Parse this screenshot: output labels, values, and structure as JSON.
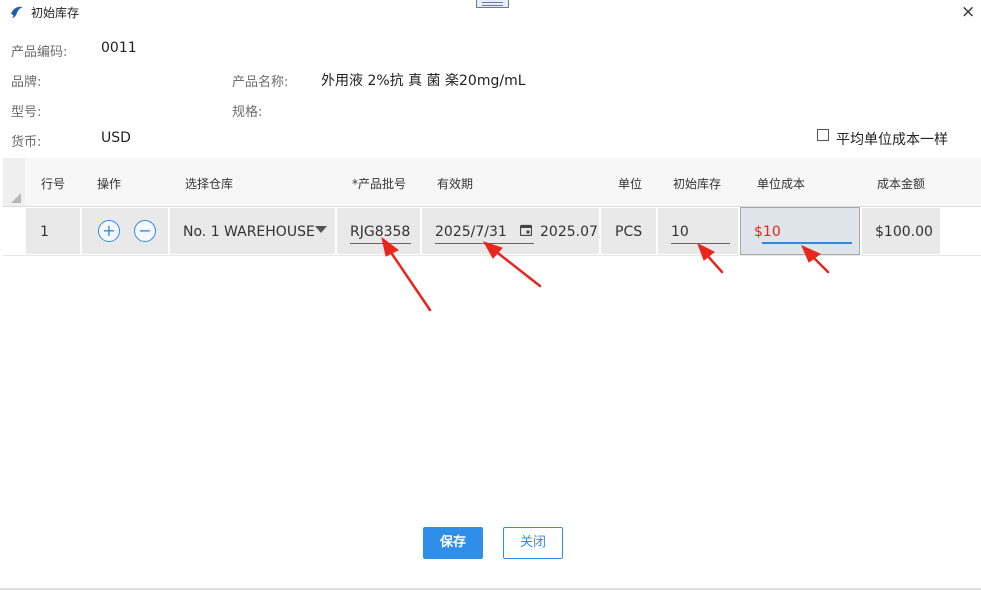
{
  "window": {
    "title": "初始库存",
    "close_glyph": "×"
  },
  "info": {
    "code_label": "产品编码:",
    "code_value": "0011",
    "brand_label": "品牌:",
    "brand_value": "",
    "name_label": "产品名称:",
    "name_value": "外用液 2%抗 真 菌 楽20mg/mL",
    "model_label": "型号:",
    "model_value": "",
    "spec_label": "规格:",
    "spec_value": "",
    "currency_label": "货币:",
    "currency_value": "USD",
    "avg_cost_label": "平均单位成本一样"
  },
  "table": {
    "headers": [
      "行号",
      "操作",
      "选择仓库",
      "*产品批号",
      "有效期",
      "单位",
      "初始库存",
      "单位成本",
      "成本金额"
    ],
    "rows": [
      {
        "line_no": "1",
        "add_glyph": "+",
        "remove_glyph": "−",
        "warehouse": "No. 1 WAREHOUSE",
        "batch": "RJG8358",
        "expiry_date": "2025/7/31",
        "expiry_short": "2025.07",
        "unit": "PCS",
        "initial_stock": "10",
        "unit_cost": "$10",
        "cost_amount": "$100.00"
      }
    ]
  },
  "buttons": {
    "save": "保存",
    "close": "关闭"
  },
  "colors": {
    "accent": "#2f8ee8",
    "annotation_arrow": "#e8261c",
    "cost_text": "#e8261c"
  },
  "icons": [
    "app-bird-icon",
    "close-icon",
    "plus-circle-icon",
    "minus-circle-icon",
    "dropdown-caret-icon",
    "calendar-icon",
    "checkbox-icon",
    "annotation-arrow-icon"
  ]
}
